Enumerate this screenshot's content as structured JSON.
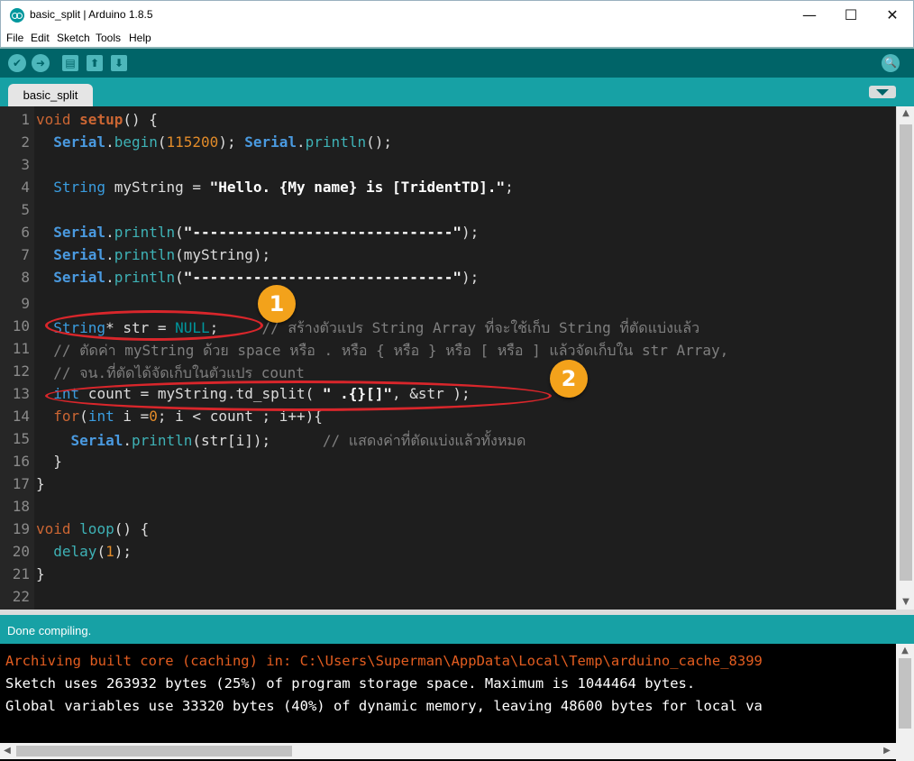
{
  "window": {
    "title": "basic_split | Arduino 1.8.5",
    "minimize": "—",
    "maximize": "☐",
    "close": "✕"
  },
  "menu": [
    "File",
    "Edit",
    "Sketch",
    "Tools",
    "Help"
  ],
  "toolbar": {
    "verify_icon": "✔",
    "upload_icon": "➜",
    "new_icon": "▤",
    "open_icon": "⬆",
    "save_icon": "⬇",
    "serial_icon": "🔍"
  },
  "tabs": [
    "basic_split"
  ],
  "editor": {
    "line_numbers": [
      "1",
      "2",
      "3",
      "4",
      "5",
      "6",
      "7",
      "8",
      "9",
      "10",
      "11",
      "12",
      "13",
      "14",
      "15",
      "16",
      "17",
      "18",
      "19",
      "20",
      "21",
      "22"
    ]
  },
  "callouts": [
    "1",
    "2"
  ],
  "status": "Done compiling.",
  "console": [
    "Archiving built core (caching) in: C:\\Users\\Superman\\AppData\\Local\\Temp\\arduino_cache_8399",
    "Sketch uses 263932 bytes (25%) of program storage space. Maximum is 1044464 bytes.",
    "Global variables use 33320 bytes (40%) of dynamic memory, leaving 48600 bytes for local va"
  ],
  "colors": {
    "toolbar": "#006468",
    "tabstrip": "#17a1a5",
    "editor_bg": "#1e1e1e",
    "callout_ring": "#d9262b",
    "callout_badge": "#f3a21b"
  }
}
